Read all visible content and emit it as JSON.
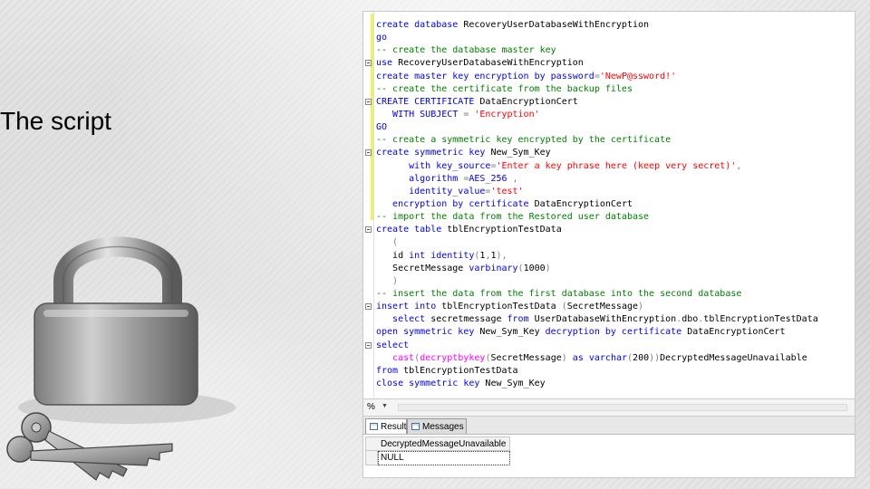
{
  "slide": {
    "title": "The script"
  },
  "editor": {
    "lines": [
      {
        "fold": false,
        "parts": [
          [
            "kw",
            "create database "
          ],
          [
            "txt",
            "RecoveryUserDatabaseWithEncryption"
          ]
        ]
      },
      {
        "fold": false,
        "parts": [
          [
            "kw",
            "go"
          ]
        ]
      },
      {
        "fold": false,
        "parts": [
          [
            "cmt",
            "-- create the database master key"
          ]
        ]
      },
      {
        "fold": true,
        "parts": [
          [
            "kw",
            "use "
          ],
          [
            "txt",
            "RecoveryUserDatabaseWithEncryption"
          ]
        ]
      },
      {
        "fold": false,
        "parts": [
          [
            "kw",
            "create master key encryption by password"
          ],
          [
            "gry",
            "="
          ],
          [
            "str",
            "'NewP@ssword!'"
          ]
        ]
      },
      {
        "fold": false,
        "parts": [
          [
            "cmt",
            "-- create the certificate from the backup files"
          ]
        ]
      },
      {
        "fold": true,
        "parts": [
          [
            "kw",
            "CREATE CERTIFICATE "
          ],
          [
            "txt",
            "DataEncryptionCert"
          ]
        ]
      },
      {
        "fold": false,
        "parts": [
          [
            "kw",
            "   WITH SUBJECT "
          ],
          [
            "gry",
            "= "
          ],
          [
            "str",
            "'Encryption'"
          ]
        ]
      },
      {
        "fold": false,
        "parts": [
          [
            "kw",
            "GO"
          ]
        ]
      },
      {
        "fold": false,
        "parts": [
          [
            "cmt",
            "-- create a symmetric key encrypted by the certificate"
          ]
        ]
      },
      {
        "fold": true,
        "parts": [
          [
            "kw",
            "create symmetric key "
          ],
          [
            "txt",
            "New_Sym_Key"
          ]
        ]
      },
      {
        "fold": false,
        "parts": [
          [
            "kw",
            "      with key_source"
          ],
          [
            "gry",
            "="
          ],
          [
            "str",
            "'Enter a key phrase here (keep very secret)'"
          ],
          [
            "gry",
            ","
          ]
        ]
      },
      {
        "fold": false,
        "parts": [
          [
            "kw",
            "      algorithm "
          ],
          [
            "gry",
            "="
          ],
          [
            "kw",
            "AES_256 "
          ],
          [
            "gry",
            ","
          ]
        ]
      },
      {
        "fold": false,
        "parts": [
          [
            "kw",
            "      identity_value"
          ],
          [
            "gry",
            "="
          ],
          [
            "str",
            "'test'"
          ]
        ]
      },
      {
        "fold": false,
        "parts": [
          [
            "kw",
            "   encryption by certificate "
          ],
          [
            "txt",
            "DataEncryptionCert"
          ]
        ]
      },
      {
        "fold": false,
        "parts": [
          [
            "cmt",
            "-- import the data from the Restored user database"
          ]
        ]
      },
      {
        "fold": true,
        "parts": [
          [
            "kw",
            "create table "
          ],
          [
            "txt",
            "tblEncryptionTestData"
          ]
        ]
      },
      {
        "fold": false,
        "parts": [
          [
            "gry",
            "   ("
          ]
        ]
      },
      {
        "fold": false,
        "parts": [
          [
            "txt",
            "   id "
          ],
          [
            "kw",
            "int identity"
          ],
          [
            "gry",
            "("
          ],
          [
            "txt",
            "1"
          ],
          [
            "gry",
            ","
          ],
          [
            "txt",
            "1"
          ],
          [
            "gry",
            "),"
          ]
        ]
      },
      {
        "fold": false,
        "parts": [
          [
            "txt",
            "   SecretMessage "
          ],
          [
            "kw",
            "varbinary"
          ],
          [
            "gry",
            "("
          ],
          [
            "txt",
            "1000"
          ],
          [
            "gry",
            ")"
          ]
        ]
      },
      {
        "fold": false,
        "parts": [
          [
            "gry",
            "   )"
          ]
        ]
      },
      {
        "fold": false,
        "parts": [
          [
            "cmt",
            "-- insert the data from the first database into the second database"
          ]
        ]
      },
      {
        "fold": true,
        "parts": [
          [
            "kw",
            "insert into "
          ],
          [
            "txt",
            "tblEncryptionTestData "
          ],
          [
            "gry",
            "("
          ],
          [
            "txt",
            "SecretMessage"
          ],
          [
            "gry",
            ")"
          ]
        ]
      },
      {
        "fold": false,
        "parts": [
          [
            "kw",
            "   select "
          ],
          [
            "txt",
            "secretmessage "
          ],
          [
            "kw",
            "from "
          ],
          [
            "txt",
            "UserDatabaseWithEncryption"
          ],
          [
            "gry",
            "."
          ],
          [
            "txt",
            "dbo"
          ],
          [
            "gry",
            "."
          ],
          [
            "txt",
            "tblEncryptionTestData"
          ]
        ]
      },
      {
        "fold": false,
        "parts": [
          [
            "kw",
            "open symmetric key "
          ],
          [
            "txt",
            "New_Sym_Key "
          ],
          [
            "kw",
            "decryption by certificate "
          ],
          [
            "txt",
            "DataEncryptionCert"
          ]
        ]
      },
      {
        "fold": true,
        "parts": [
          [
            "kw",
            "select"
          ]
        ]
      },
      {
        "fold": false,
        "parts": [
          [
            "fn",
            "   cast"
          ],
          [
            "gry",
            "("
          ],
          [
            "fn",
            "decryptbykey"
          ],
          [
            "gry",
            "("
          ],
          [
            "txt",
            "SecretMessage"
          ],
          [
            "gry",
            ") "
          ],
          [
            "kw",
            "as varchar"
          ],
          [
            "gry",
            "("
          ],
          [
            "txt",
            "200"
          ],
          [
            "gry",
            "))"
          ],
          [
            "txt",
            "DecryptedMessageUnavailable"
          ]
        ]
      },
      {
        "fold": false,
        "parts": [
          [
            "kw",
            "from "
          ],
          [
            "txt",
            "tblEncryptionTestData"
          ]
        ]
      },
      {
        "fold": false,
        "parts": [
          [
            "kw",
            "close symmetric key "
          ],
          [
            "txt",
            "New_Sym_Key"
          ]
        ]
      }
    ]
  },
  "status": {
    "zoom": "%"
  },
  "tabs": [
    {
      "label": "Results",
      "active": true
    },
    {
      "label": "Messages",
      "active": false
    }
  ],
  "results": {
    "column": "DecryptedMessageUnavailable",
    "value": "NULL"
  }
}
